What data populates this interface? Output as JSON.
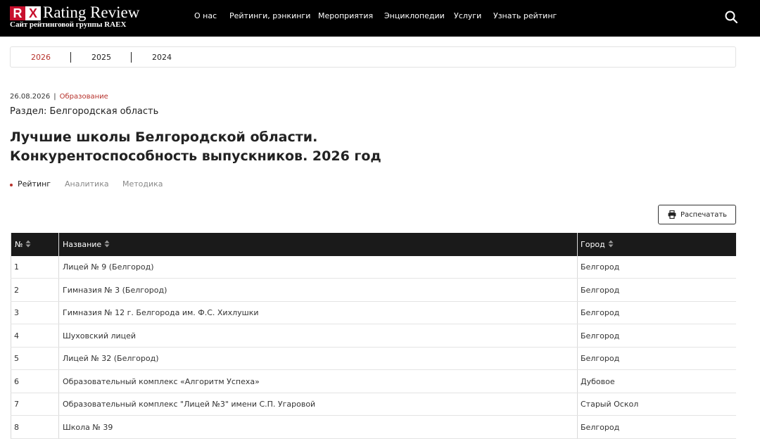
{
  "header": {
    "logo_mark_r": "R",
    "logo_mark_x": "X",
    "logo_title": "Rating Review",
    "logo_subtitle": "Сайт рейтинговой группы RAEX",
    "nav": [
      "О нас",
      "Рейтинги, рэнкинги",
      "Мероприятия",
      "Энциклопедии",
      "Услуги",
      "Узнать рейтинг"
    ],
    "search_icon": "search-icon"
  },
  "years": {
    "items": [
      "2026",
      "2025",
      "2024"
    ],
    "active": "2026"
  },
  "article": {
    "date": "26.08.2026",
    "separator": "|",
    "category": "Образование",
    "section": "Раздел: Белгородская область",
    "title_line1": "Лучшие школы Белгородской области.",
    "title_line2": "Конкурентоспособность выпускников. 2026 год"
  },
  "tabs": [
    "Рейтинг",
    "Аналитика",
    "Методика"
  ],
  "print": {
    "label": "Распечатать",
    "icon": "printer-icon"
  },
  "table": {
    "headers": [
      "№",
      "Название",
      "Город"
    ],
    "rows": [
      [
        "1",
        "Лицей № 9 (Белгород)",
        "Белгород"
      ],
      [
        "2",
        "Гимназия № 3 (Белгород)",
        "Белгород"
      ],
      [
        "3",
        "Гимназия № 12 г. Белгорода им. Ф.С. Хихлушки",
        "Белгород"
      ],
      [
        "4",
        "Шуховский лицей",
        "Белгород"
      ],
      [
        "5",
        "Лицей № 32 (Белгород)",
        "Белгород"
      ],
      [
        "6",
        "Образовательный комплекс «Алгоритм Успеха»",
        "Дубовое"
      ],
      [
        "7",
        "Образовательный комплекс \"Лицей №3\" имени С.П. Угаровой",
        "Старый Оскол"
      ],
      [
        "8",
        "Школа № 39",
        "Белгород"
      ]
    ]
  },
  "colors": {
    "accent": "#b7322c",
    "header_bg": "#000000",
    "table_head_bg": "#1a1a1a"
  }
}
